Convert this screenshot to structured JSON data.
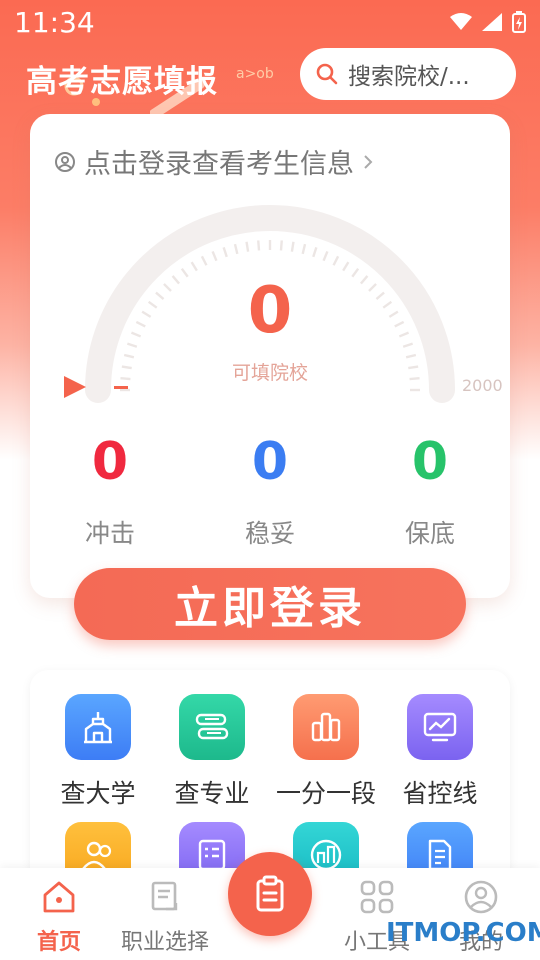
{
  "status_bar": {
    "time": "11:34"
  },
  "header": {
    "title": "高考志愿填报",
    "search_placeholder": "搜索院校/..."
  },
  "main_card": {
    "login_hint": "点击登录查看考生信息",
    "gauge": {
      "value": "0",
      "label": "可填院校",
      "max": "2000"
    },
    "stats": [
      {
        "value": "0",
        "label": "冲击",
        "color": "#f0293f"
      },
      {
        "value": "0",
        "label": "稳妥",
        "color": "#3b7df2"
      },
      {
        "value": "0",
        "label": "保底",
        "color": "#27c36a"
      }
    ]
  },
  "login_button": {
    "label": "立即登录"
  },
  "tools": [
    {
      "label": "查大学",
      "icon": "university-icon",
      "color_top": "#5aa6ff",
      "color_bottom": "#3d7df5"
    },
    {
      "label": "查专业",
      "icon": "books-icon",
      "color_top": "#34d8a8",
      "color_bottom": "#1db98c"
    },
    {
      "label": "一分一段",
      "icon": "bar-chart-icon",
      "color_top": "#ff9b72",
      "color_bottom": "#f5704d"
    },
    {
      "label": "省控线",
      "icon": "monitor-chart-icon",
      "color_top": "#a58bff",
      "color_bottom": "#7b63f0"
    },
    {
      "label": "",
      "icon": "users-icon",
      "color_top": "#ffc03d",
      "color_bottom": "#f7a51c"
    },
    {
      "label": "",
      "icon": "form-list-icon",
      "color_top": "#a58bff",
      "color_bottom": "#7b63f0"
    },
    {
      "label": "",
      "icon": "city-icon",
      "color_top": "#34d6d6",
      "color_bottom": "#15b8c2"
    },
    {
      "label": "",
      "icon": "document-icon",
      "color_top": "#5aa6ff",
      "color_bottom": "#3d7df5"
    }
  ],
  "tab_bar": {
    "tabs": [
      {
        "label": "首页",
        "icon": "home-icon",
        "active": true
      },
      {
        "label": "职业选择",
        "icon": "career-icon",
        "active": false
      },
      {
        "label": "小工具",
        "icon": "grid-icon",
        "active": false
      },
      {
        "label": "我的",
        "icon": "profile-icon",
        "active": false
      }
    ],
    "center_icon": "clipboard-icon"
  },
  "watermark": "ITMOP.COM",
  "colors": {
    "accent": "#f4634c"
  }
}
